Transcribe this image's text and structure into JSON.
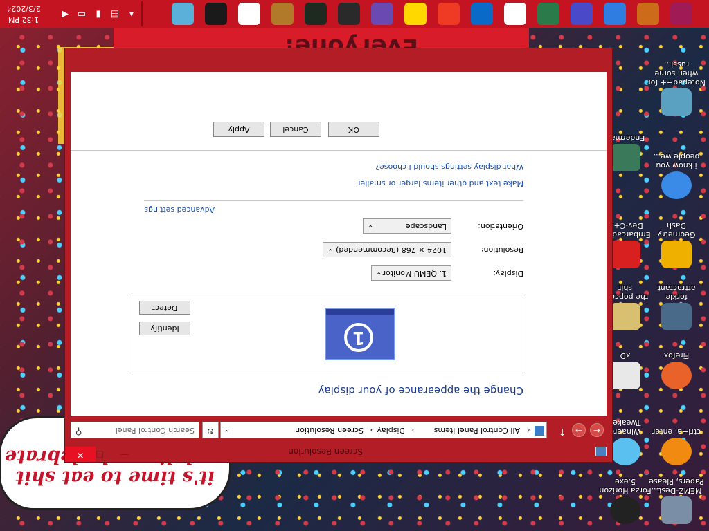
{
  "wallpaper": {
    "top_text": "Everyone!",
    "bubble_line1": "it's time to eat shit",
    "bubble_line2": "and die andcelebrate"
  },
  "desktop_icons": [
    {
      "label": "MEMZ-Dest... Papers, Please",
      "icon": "memz-icon"
    },
    {
      "label": "Forza Horizon 5.exe",
      "icon": "forza-icon"
    },
    {
      "label": "ctrl+a, enter",
      "icon": "orange-circle-icon"
    },
    {
      "label": "Winaero Tweaker",
      "icon": "winaero-icon"
    },
    {
      "label": "Firefox",
      "icon": "firefox-icon"
    },
    {
      "label": "xD",
      "icon": "xd-icon"
    },
    {
      "label": "forkie attractant",
      "icon": "gear-window-icon"
    },
    {
      "label": "the popcorn shit",
      "icon": "popcorn-icon"
    },
    {
      "label": "Geometry Dash",
      "icon": "geometry-dash-icon"
    },
    {
      "label": "Embarcadero Dev-C++",
      "icon": "devcpp-icon"
    },
    {
      "label": "i know you people we...",
      "icon": "chrome-icon"
    },
    {
      "label": "Enderman",
      "icon": "enderman-icon"
    },
    {
      "label": "Notepad++ for when some russi...",
      "icon": "notepad-icon"
    }
  ],
  "window": {
    "title": "Screen Resolution",
    "close_symbol": "✕",
    "minimize_symbol": "—",
    "maximize_symbol": "▢",
    "nav": {
      "back": "←",
      "forward": "→",
      "up": "↑"
    },
    "breadcrumb": [
      "«",
      "All Control Panel Items",
      "›",
      "Display",
      "›",
      "Screen Resolution"
    ],
    "breadcrumb_dropdown": "⌄",
    "refresh": "↻",
    "search_placeholder": "Search Control Panel",
    "search_icon": "⚲"
  },
  "main": {
    "heading": "Change the appearance of your display",
    "monitor_number": "1",
    "detect_label": "Detect",
    "identify_label": "Identify",
    "display_label": "Display:",
    "display_value": "1. QEMU Monitor",
    "resolution_label": "Resolution:",
    "resolution_value": "1024 × 768 (Recommended)",
    "orientation_label": "Orientation:",
    "orientation_value": "Landscape",
    "dropdown_arrow": "⌄",
    "advanced_link": "Advanced settings",
    "link_text_size": "Make text and other items larger or smaller",
    "link_which_settings": "What display settings should I choose?"
  },
  "footer": {
    "ok": "OK",
    "cancel": "Cancel",
    "apply": "Apply"
  },
  "taskbar": {
    "time": "1:32 PM",
    "date": "2/3/2024",
    "show_hidden_symbol": "▴",
    "apps": [
      {
        "name": "glitch-app-icon",
        "color": "#a01a55"
      },
      {
        "name": "chromium-icon",
        "color": "#cc6b1a"
      },
      {
        "name": "chrome-icon",
        "color": "#2f7de0"
      },
      {
        "name": "settings-icon",
        "color": "#4a4ac8"
      },
      {
        "name": "paint-icon",
        "color": "#2b7a4a"
      },
      {
        "name": "7zip-icon",
        "color": "#ffffff"
      },
      {
        "name": "outlook-icon",
        "color": "#0a6ac7"
      },
      {
        "name": "yandex-icon",
        "color": "#ef3b24"
      },
      {
        "name": "yahoo-icon",
        "color": "#ffd800"
      },
      {
        "name": "cat-app-icon",
        "color": "#6a4ab0"
      },
      {
        "name": "wot-icon",
        "color": "#2a2a2a"
      },
      {
        "name": "tanks-icon",
        "color": "#1e2a20"
      },
      {
        "name": "crossed-tools-icon",
        "color": "#b07a2a"
      },
      {
        "name": "red-triad-icon",
        "color": "#ffffff"
      },
      {
        "name": "terminal-icon",
        "color": "#1a1a1a"
      },
      {
        "name": "window-app-icon",
        "color": "#5ab0d8"
      }
    ]
  }
}
